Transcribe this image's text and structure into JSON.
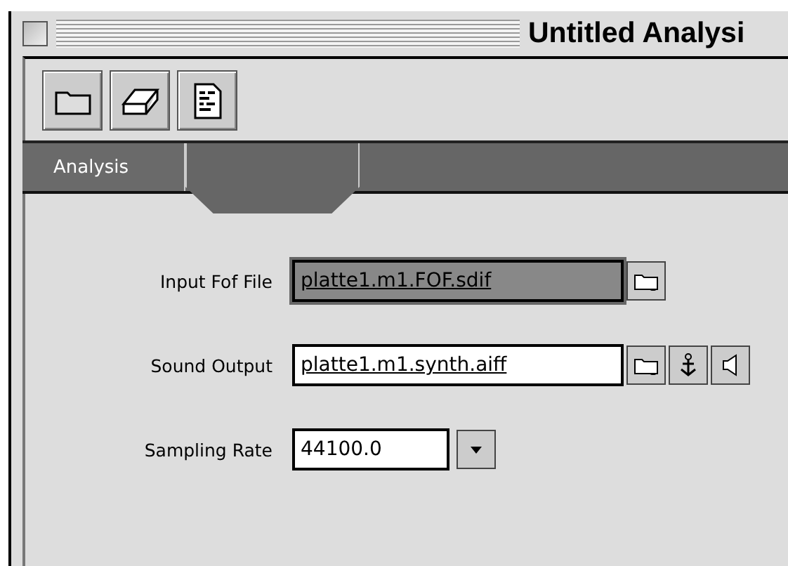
{
  "window": {
    "title": "Untitled Analysi"
  },
  "tabs": [
    {
      "label": "Analysis",
      "selected": false
    },
    {
      "selected": true
    }
  ],
  "fields": [
    {
      "kind": "file",
      "label": "Input Fof File",
      "value": "platte1.m1.FOF.sdif",
      "selected": true
    },
    {
      "kind": "sound",
      "label": "Sound Output",
      "value": "platte1.m1.synth.aiff",
      "selected": false
    },
    {
      "kind": "menu",
      "label": "Sampling Rate",
      "value": "44100.0",
      "selected": false
    }
  ]
}
